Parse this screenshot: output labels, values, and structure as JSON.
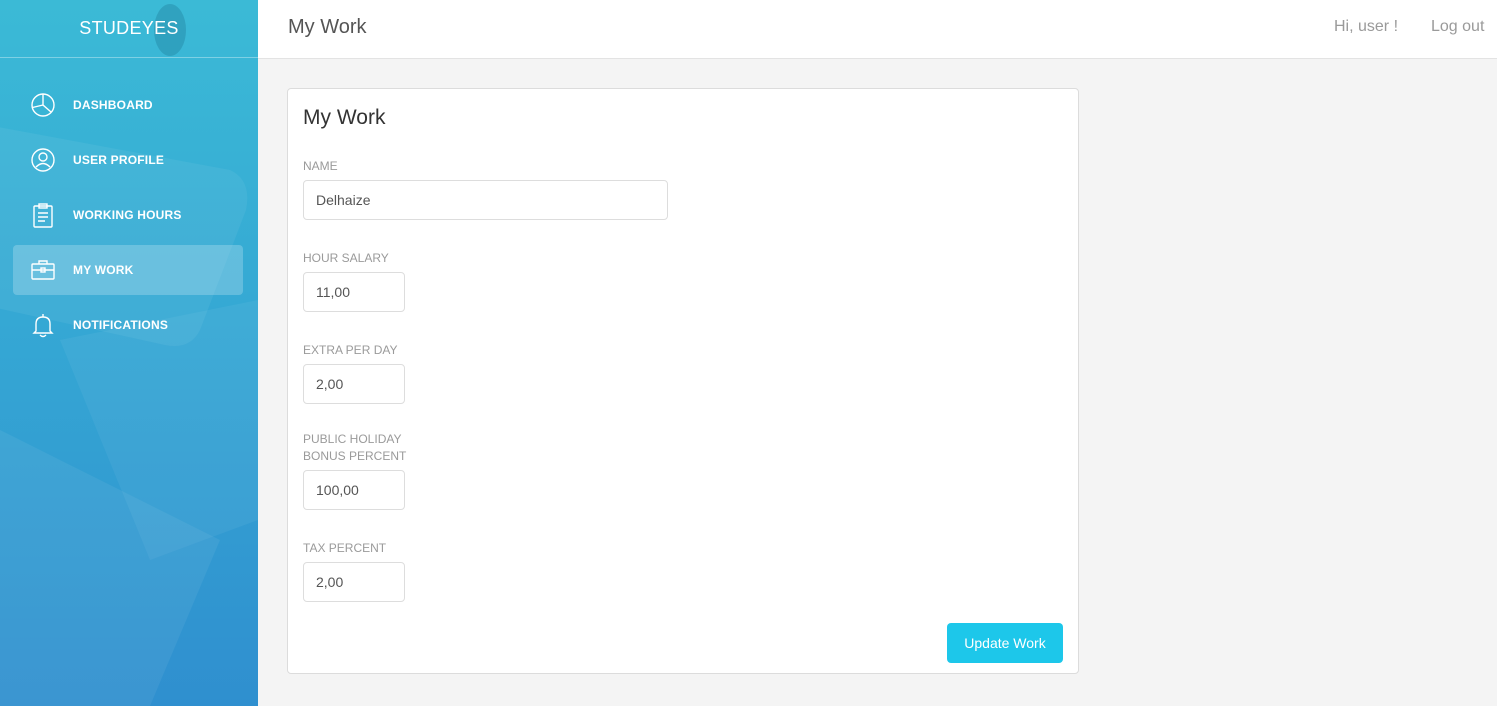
{
  "brand": "STUDEYES",
  "sidebar": {
    "items": [
      {
        "label": "DASHBOARD",
        "icon": "pie-chart-icon"
      },
      {
        "label": "USER PROFILE",
        "icon": "user-icon"
      },
      {
        "label": "WORKING HOURS",
        "icon": "clipboard-icon"
      },
      {
        "label": "MY WORK",
        "icon": "briefcase-icon",
        "active": true
      },
      {
        "label": "NOTIFICATIONS",
        "icon": "bell-icon"
      }
    ]
  },
  "header": {
    "title": "My Work",
    "greeting": "Hi, user !",
    "logout": "Log out"
  },
  "form": {
    "title": "My Work",
    "name": {
      "label": "NAME",
      "value": "Delhaize"
    },
    "hour_salary": {
      "label": "HOUR SALARY",
      "value": "11,00"
    },
    "extra_per_day": {
      "label": "EXTRA PER DAY",
      "value": "2,00"
    },
    "holiday_bonus": {
      "label_line1": "PUBLIC HOLIDAY",
      "label_line2": "BONUS PERCENT",
      "value": "100,00"
    },
    "tax_percent": {
      "label": "TAX PERCENT",
      "value": "2,00"
    },
    "submit_label": "Update Work"
  },
  "colors": {
    "sidebar_top": "#3bbad6",
    "sidebar_bottom": "#2f8fcf",
    "accent": "#1dc7ea"
  }
}
